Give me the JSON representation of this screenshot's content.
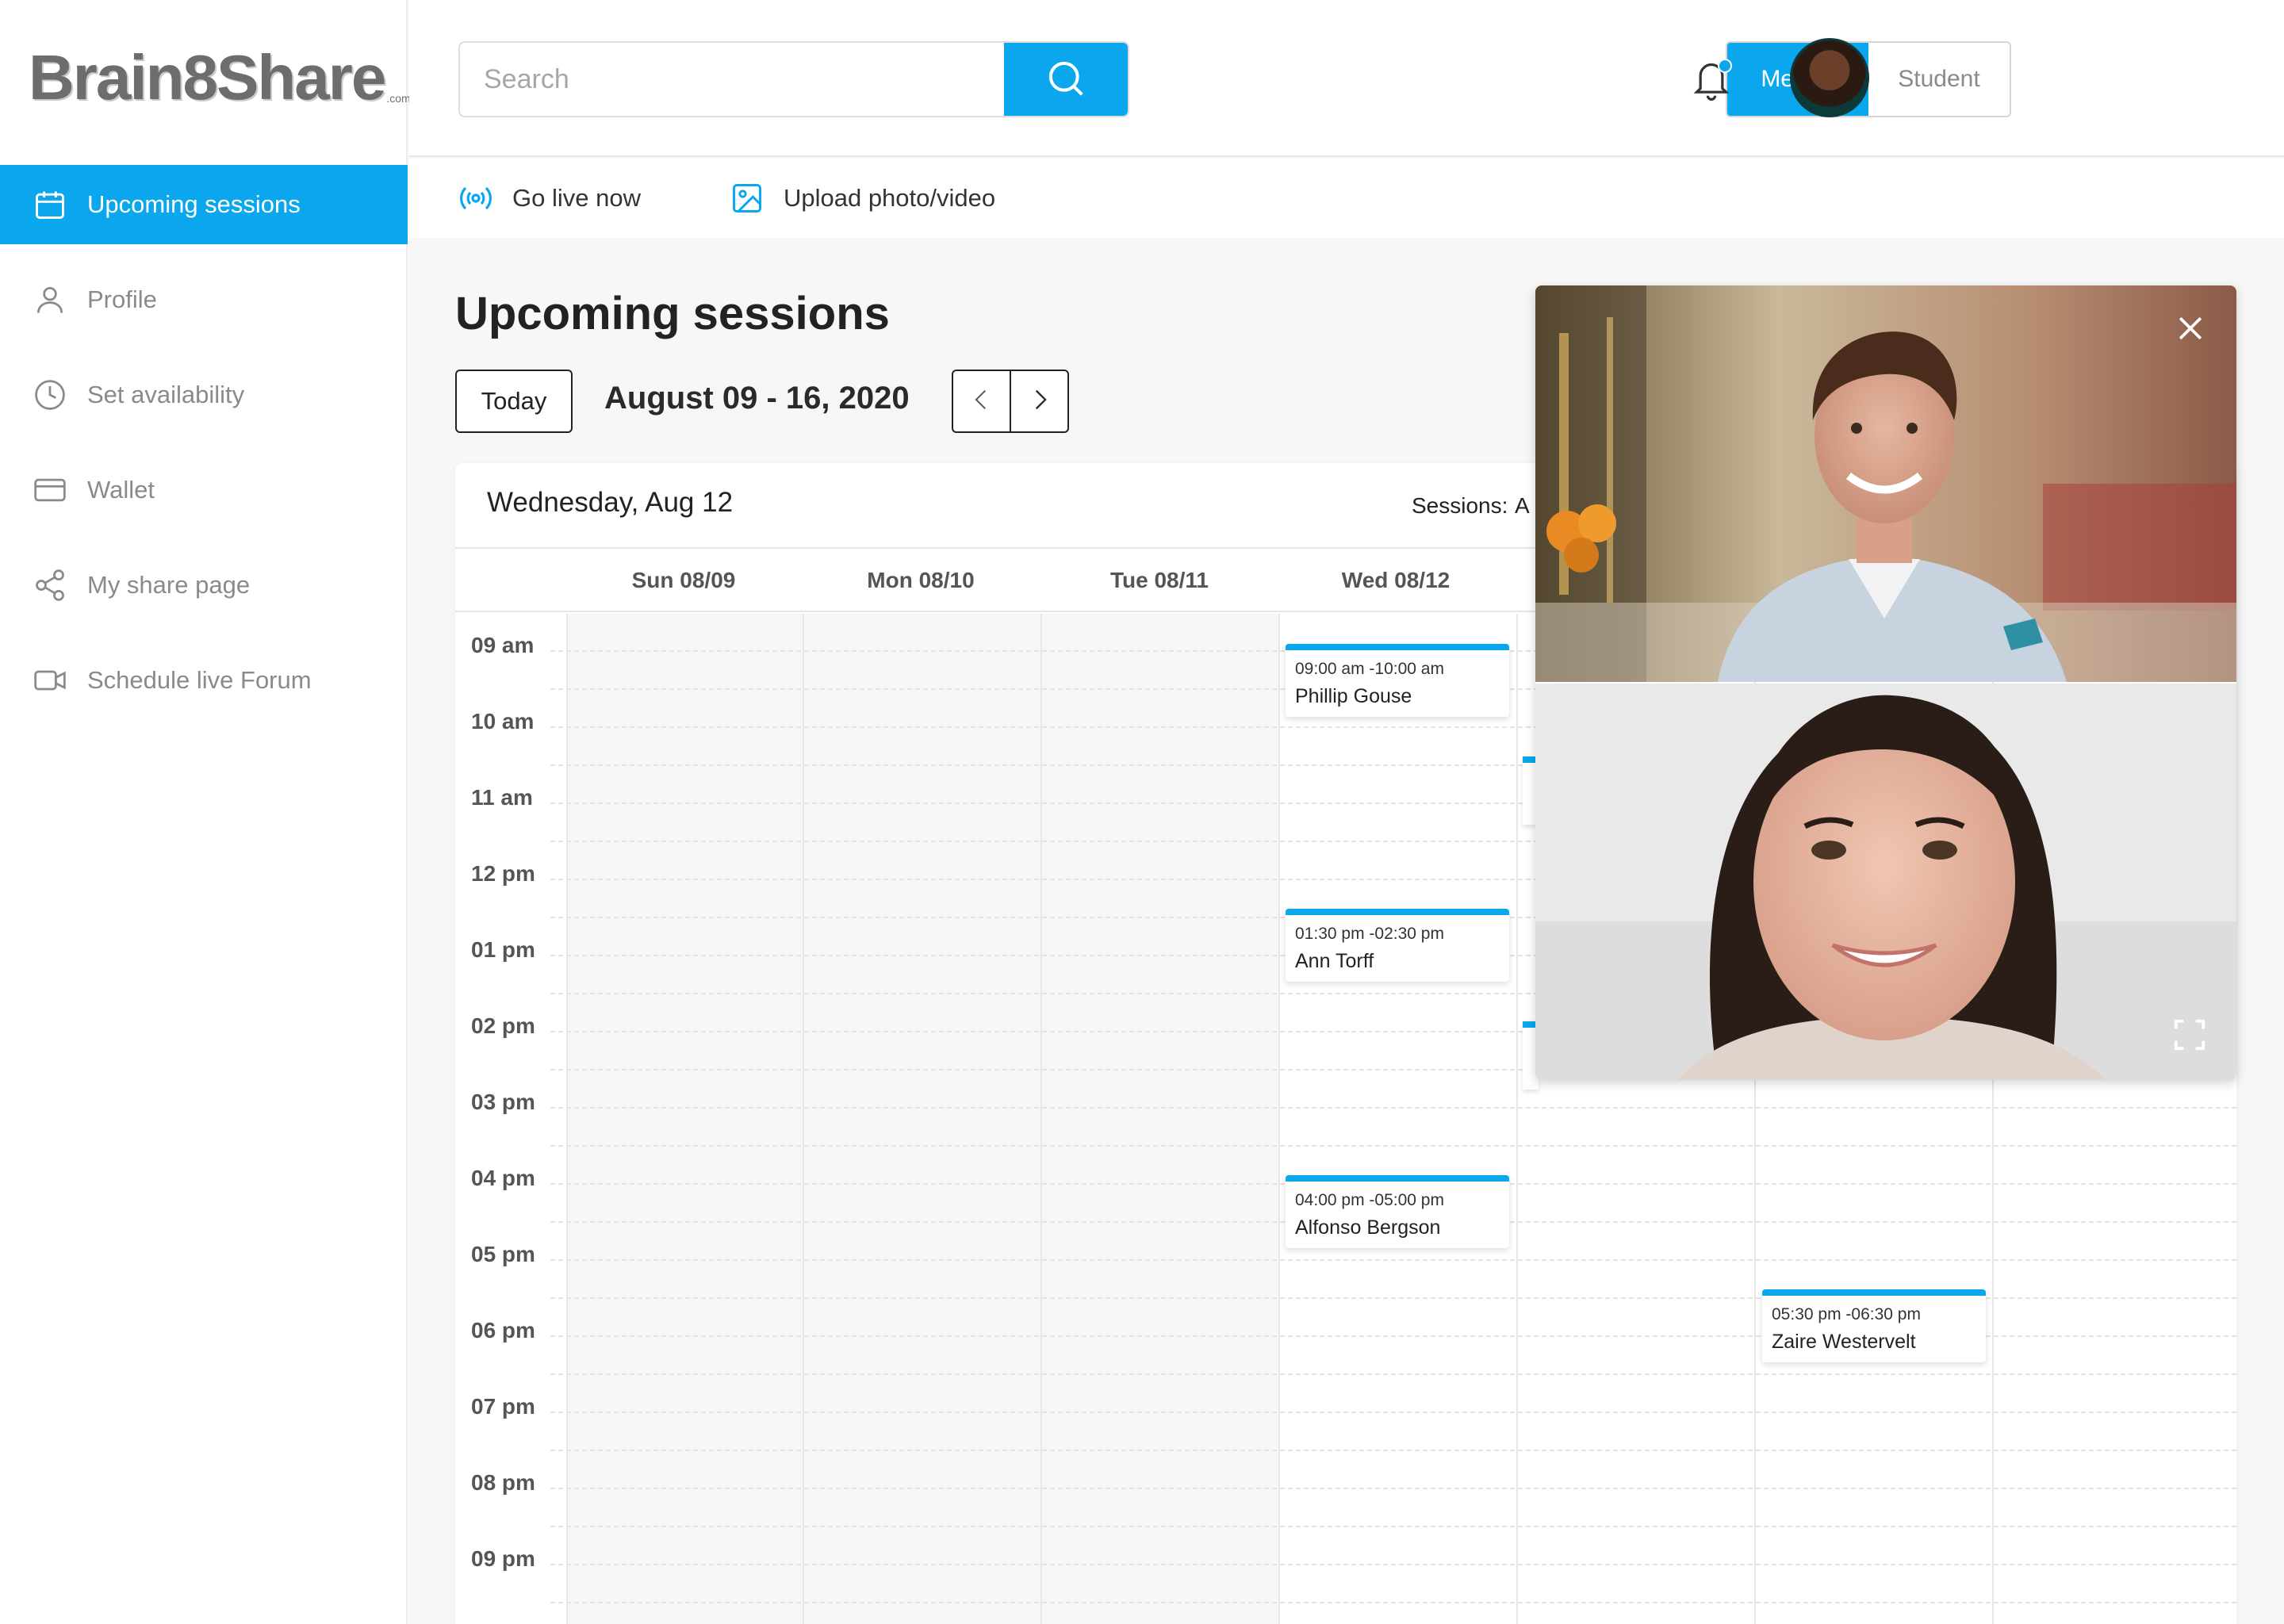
{
  "app": {
    "logo_text": "Brain8Share",
    "logo_suffix": ".com"
  },
  "sidebar": {
    "items": [
      {
        "label": "Upcoming sessions",
        "icon": "calendar-icon",
        "active": true
      },
      {
        "label": "Profile",
        "icon": "user-icon",
        "active": false
      },
      {
        "label": "Set availability",
        "icon": "clock-icon",
        "active": false
      },
      {
        "label": "Wallet",
        "icon": "wallet-card-icon",
        "active": false
      },
      {
        "label": "My share page",
        "icon": "share-icon",
        "active": false
      },
      {
        "label": "Schedule live Forum",
        "icon": "video-camera-icon",
        "active": false
      }
    ]
  },
  "header": {
    "search": {
      "placeholder": "Search",
      "value": ""
    },
    "roles": {
      "mentor": "Mentor",
      "student": "Student",
      "selected": "Mentor"
    },
    "notifications": {
      "has_unread": true
    },
    "accent": "#0aa7ee"
  },
  "toolbar": {
    "go_live": "Go live now",
    "upload": "Upload photo/video"
  },
  "main": {
    "title": "Upcoming sessions",
    "today_label": "Today",
    "date_range": "August 09 - 16, 2020",
    "selected_date": "Wednesday, Aug 12",
    "sessions_label": "Sessions:",
    "sessions_value": "A"
  },
  "calendar": {
    "days": [
      "Sun 08/09",
      "Mon 08/10",
      "Tue 08/11",
      "Wed 08/12"
    ],
    "hours": [
      "09 am",
      "10 am",
      "11 am",
      "12 pm",
      "01 pm",
      "02 pm",
      "03 pm",
      "04 pm",
      "05 pm",
      "06 pm",
      "07 pm",
      "08 pm",
      "09 pm"
    ],
    "events": [
      {
        "time": "09:00 am -10:00 am",
        "name": "Phillip Gouse"
      },
      {
        "time": "01:30 pm -02:30 pm",
        "name": "Ann Torff"
      },
      {
        "time": "04:00 pm -05:00 pm",
        "name": "Alfonso Bergson"
      },
      {
        "time": "05:30 pm -06:30 pm",
        "name": "Zaire Westervelt"
      }
    ]
  },
  "video_call": {
    "close_icon": "close-icon",
    "expand_icon": "fullscreen-icon"
  }
}
